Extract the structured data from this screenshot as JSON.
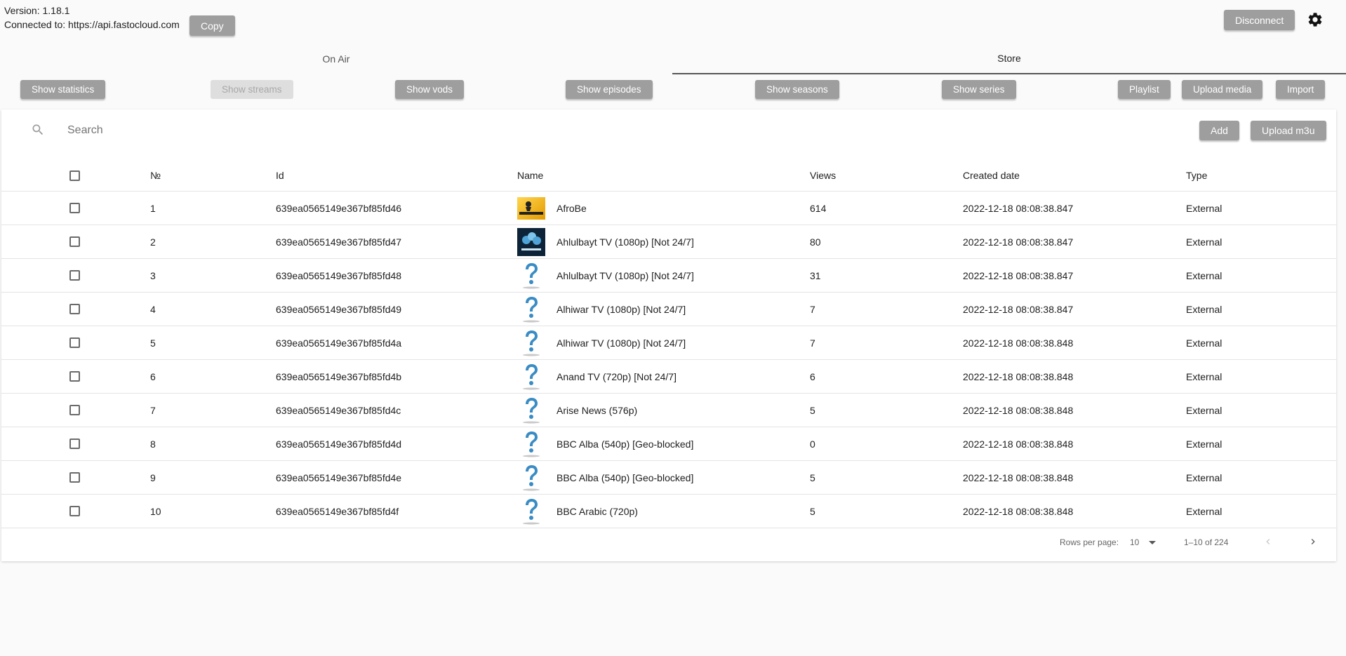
{
  "header": {
    "version": "Version: 1.18.1",
    "connected": "Connected to: https://api.fastocloud.com",
    "copy_label": "Copy",
    "disconnect_label": "Disconnect"
  },
  "tabs": [
    {
      "label": "On Air"
    },
    {
      "label": "Store"
    }
  ],
  "actions": {
    "show_statistics": "Show statistics",
    "show_streams": "Show streams",
    "show_vods": "Show vods",
    "show_episodes": "Show episodes",
    "show_seasons": "Show seasons",
    "show_series": "Show series",
    "playlist": "Playlist",
    "upload_media": "Upload media",
    "import": "Import"
  },
  "search": {
    "placeholder": "Search"
  },
  "toolbar": {
    "add_label": "Add",
    "upload_m3u_label": "Upload m3u"
  },
  "table": {
    "columns": [
      "№",
      "Id",
      "Name",
      "Views",
      "Created date",
      "Type"
    ],
    "rows": [
      {
        "n": "1",
        "id": "639ea0565149e367bf85fd46",
        "name": "AfroBe",
        "views": "614",
        "created": "2022-12-18 08:08:38.847",
        "type": "External",
        "logo": "afrobe-logo"
      },
      {
        "n": "2",
        "id": "639ea0565149e367bf85fd47",
        "name": "Ahlulbayt TV (1080p) [Not 24/7]",
        "views": "80",
        "created": "2022-12-18 08:08:38.847",
        "type": "External",
        "logo": "ahlulbayt-logo"
      },
      {
        "n": "3",
        "id": "639ea0565149e367bf85fd48",
        "name": "Ahlulbayt TV (1080p) [Not 24/7]",
        "views": "31",
        "created": "2022-12-18 08:08:38.847",
        "type": "External",
        "logo": "question-icon"
      },
      {
        "n": "4",
        "id": "639ea0565149e367bf85fd49",
        "name": "Alhiwar TV (1080p) [Not 24/7]",
        "views": "7",
        "created": "2022-12-18 08:08:38.847",
        "type": "External",
        "logo": "question-icon"
      },
      {
        "n": "5",
        "id": "639ea0565149e367bf85fd4a",
        "name": "Alhiwar TV (1080p) [Not 24/7]",
        "views": "7",
        "created": "2022-12-18 08:08:38.848",
        "type": "External",
        "logo": "question-icon"
      },
      {
        "n": "6",
        "id": "639ea0565149e367bf85fd4b",
        "name": "Anand TV (720p) [Not 24/7]",
        "views": "6",
        "created": "2022-12-18 08:08:38.848",
        "type": "External",
        "logo": "question-icon"
      },
      {
        "n": "7",
        "id": "639ea0565149e367bf85fd4c",
        "name": "Arise News (576p)",
        "views": "5",
        "created": "2022-12-18 08:08:38.848",
        "type": "External",
        "logo": "question-icon"
      },
      {
        "n": "8",
        "id": "639ea0565149e367bf85fd4d",
        "name": "BBC Alba (540p) [Geo-blocked]",
        "views": "0",
        "created": "2022-12-18 08:08:38.848",
        "type": "External",
        "logo": "question-icon"
      },
      {
        "n": "9",
        "id": "639ea0565149e367bf85fd4e",
        "name": "BBC Alba (540p) [Geo-blocked]",
        "views": "5",
        "created": "2022-12-18 08:08:38.848",
        "type": "External",
        "logo": "question-icon"
      },
      {
        "n": "10",
        "id": "639ea0565149e367bf85fd4f",
        "name": "BBC Arabic (720p)",
        "views": "5",
        "created": "2022-12-18 08:08:38.848",
        "type": "External",
        "logo": "question-icon"
      }
    ]
  },
  "pagination": {
    "rows_per_page_label": "Rows per page:",
    "rows_per_page_value": "10",
    "range": "1–10 of 224"
  }
}
